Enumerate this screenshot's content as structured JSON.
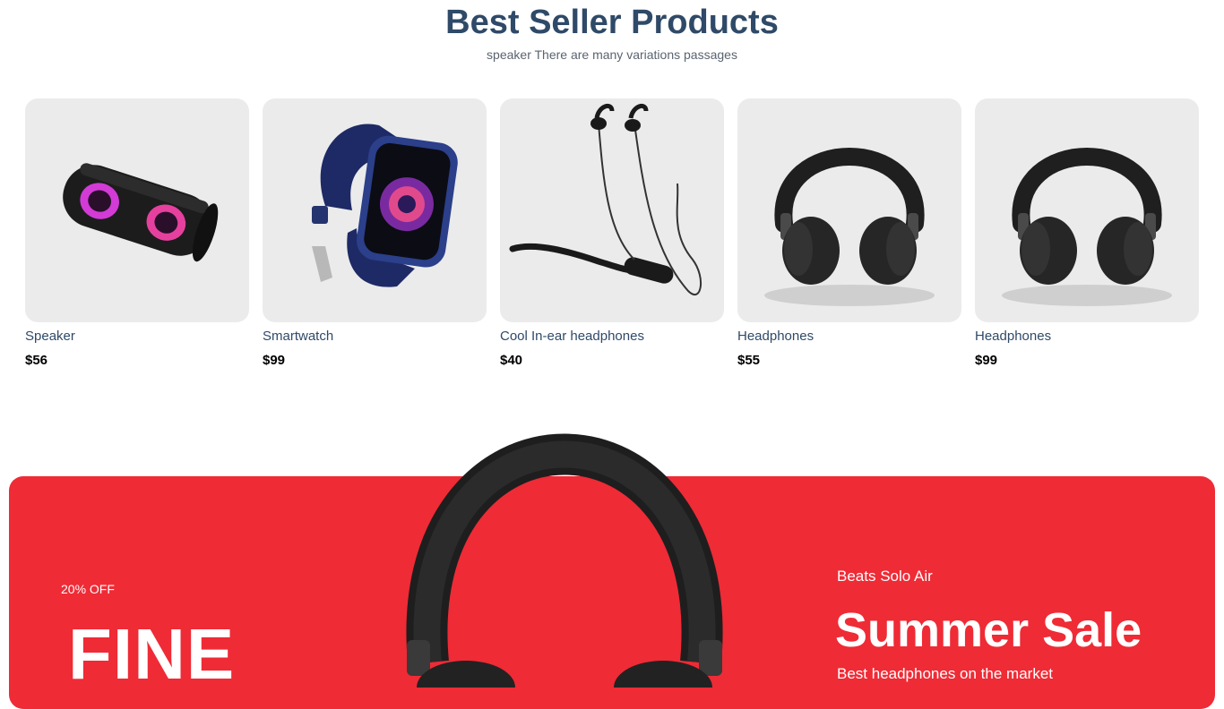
{
  "section": {
    "title": "Best Seller Products",
    "subtitle": "speaker There are many variations passages"
  },
  "products": [
    {
      "name": "Speaker",
      "price": "$56",
      "icon": "speaker-image"
    },
    {
      "name": "Smartwatch",
      "price": "$99",
      "icon": "smartwatch-image"
    },
    {
      "name": "Cool In-ear headphones",
      "price": "$40",
      "icon": "neckband-earphones-image"
    },
    {
      "name": "Headphones",
      "price": "$55",
      "icon": "headphones-image"
    },
    {
      "name": "Headphones",
      "price": "$99",
      "icon": "headphones-image"
    }
  ],
  "banner": {
    "discount": "20% OFF",
    "big_text": "FINE",
    "product": "Beats Solo Air",
    "headline": "Summer Sale",
    "tagline": "Best headphones on the market",
    "background": "#ef2b36"
  },
  "colors": {
    "heading": "#2f4a68",
    "card_bg": "#ebebeb",
    "banner_red": "#ef2b36"
  }
}
